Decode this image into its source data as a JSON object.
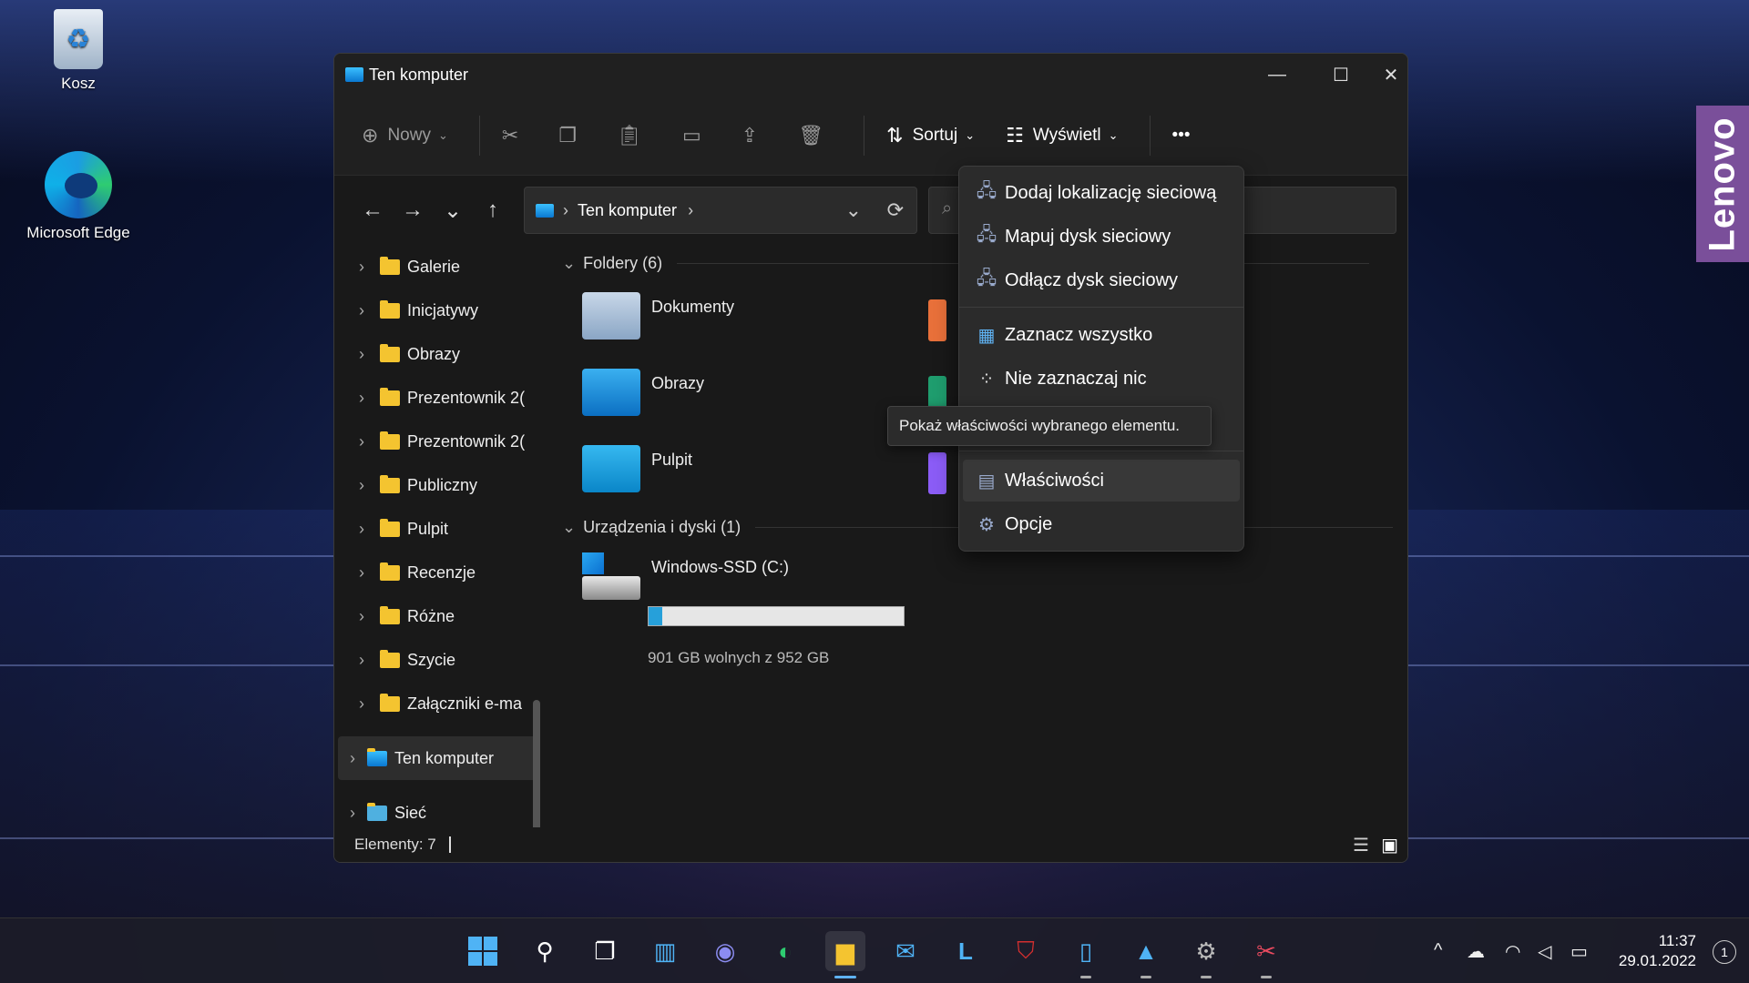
{
  "desktop": {
    "icons": [
      {
        "label": "Kosz"
      },
      {
        "label": "Microsoft Edge"
      }
    ],
    "brand": "Lenovo"
  },
  "window": {
    "title": "Ten komputer",
    "controls": {
      "minimize": "—",
      "maximize": "☐",
      "close": "✕"
    }
  },
  "toolbar": {
    "new_label": "Nowy",
    "sort_label": "Sortuj",
    "view_label": "Wyświetl",
    "more_label": "•••"
  },
  "nav": {
    "address_segments": [
      "Ten komputer"
    ],
    "back": "←",
    "forward": "→",
    "recent": "⌄",
    "up": "↑",
    "refresh": "⟳"
  },
  "sidebar": {
    "items": [
      {
        "label": "Galerie"
      },
      {
        "label": "Inicjatywy"
      },
      {
        "label": "Obrazy"
      },
      {
        "label": "Prezentownik 2("
      },
      {
        "label": "Prezentownik 2("
      },
      {
        "label": "Publiczny"
      },
      {
        "label": "Pulpit"
      },
      {
        "label": "Recenzje"
      },
      {
        "label": "Różne"
      },
      {
        "label": "Szycie"
      },
      {
        "label": "Załączniki e-ma"
      }
    ],
    "this_pc": "Ten komputer",
    "network": "Sieć"
  },
  "content": {
    "folders_header": "Foldery (6)",
    "folders": [
      {
        "label": "Dokumenty"
      },
      {
        "label": "Obrazy"
      },
      {
        "label": "Pulpit"
      }
    ],
    "devices_header": "Urządzenia i dyski (1)",
    "drive": {
      "label": "Windows-SSD (C:)",
      "free_text": "901 GB wolnych z 952 GB",
      "used_fraction": 0.054
    }
  },
  "status": {
    "items_text": "Elementy: 7"
  },
  "context_menu": {
    "items": [
      {
        "label": "Dodaj lokalizację sieciową"
      },
      {
        "label": "Mapuj dysk sieciowy"
      },
      {
        "label": "Odłącz dysk sieciowy"
      },
      {
        "label": "Zaznacz wszystko"
      },
      {
        "label": "Nie zaznaczaj nic"
      },
      {
        "label": "Właściwości"
      },
      {
        "label": "Opcje"
      }
    ],
    "tooltip": "Pokaż właściwości wybranego elementu."
  },
  "taskbar": {
    "time": "11:37",
    "date": "29.01.2022",
    "notifications": "1"
  }
}
